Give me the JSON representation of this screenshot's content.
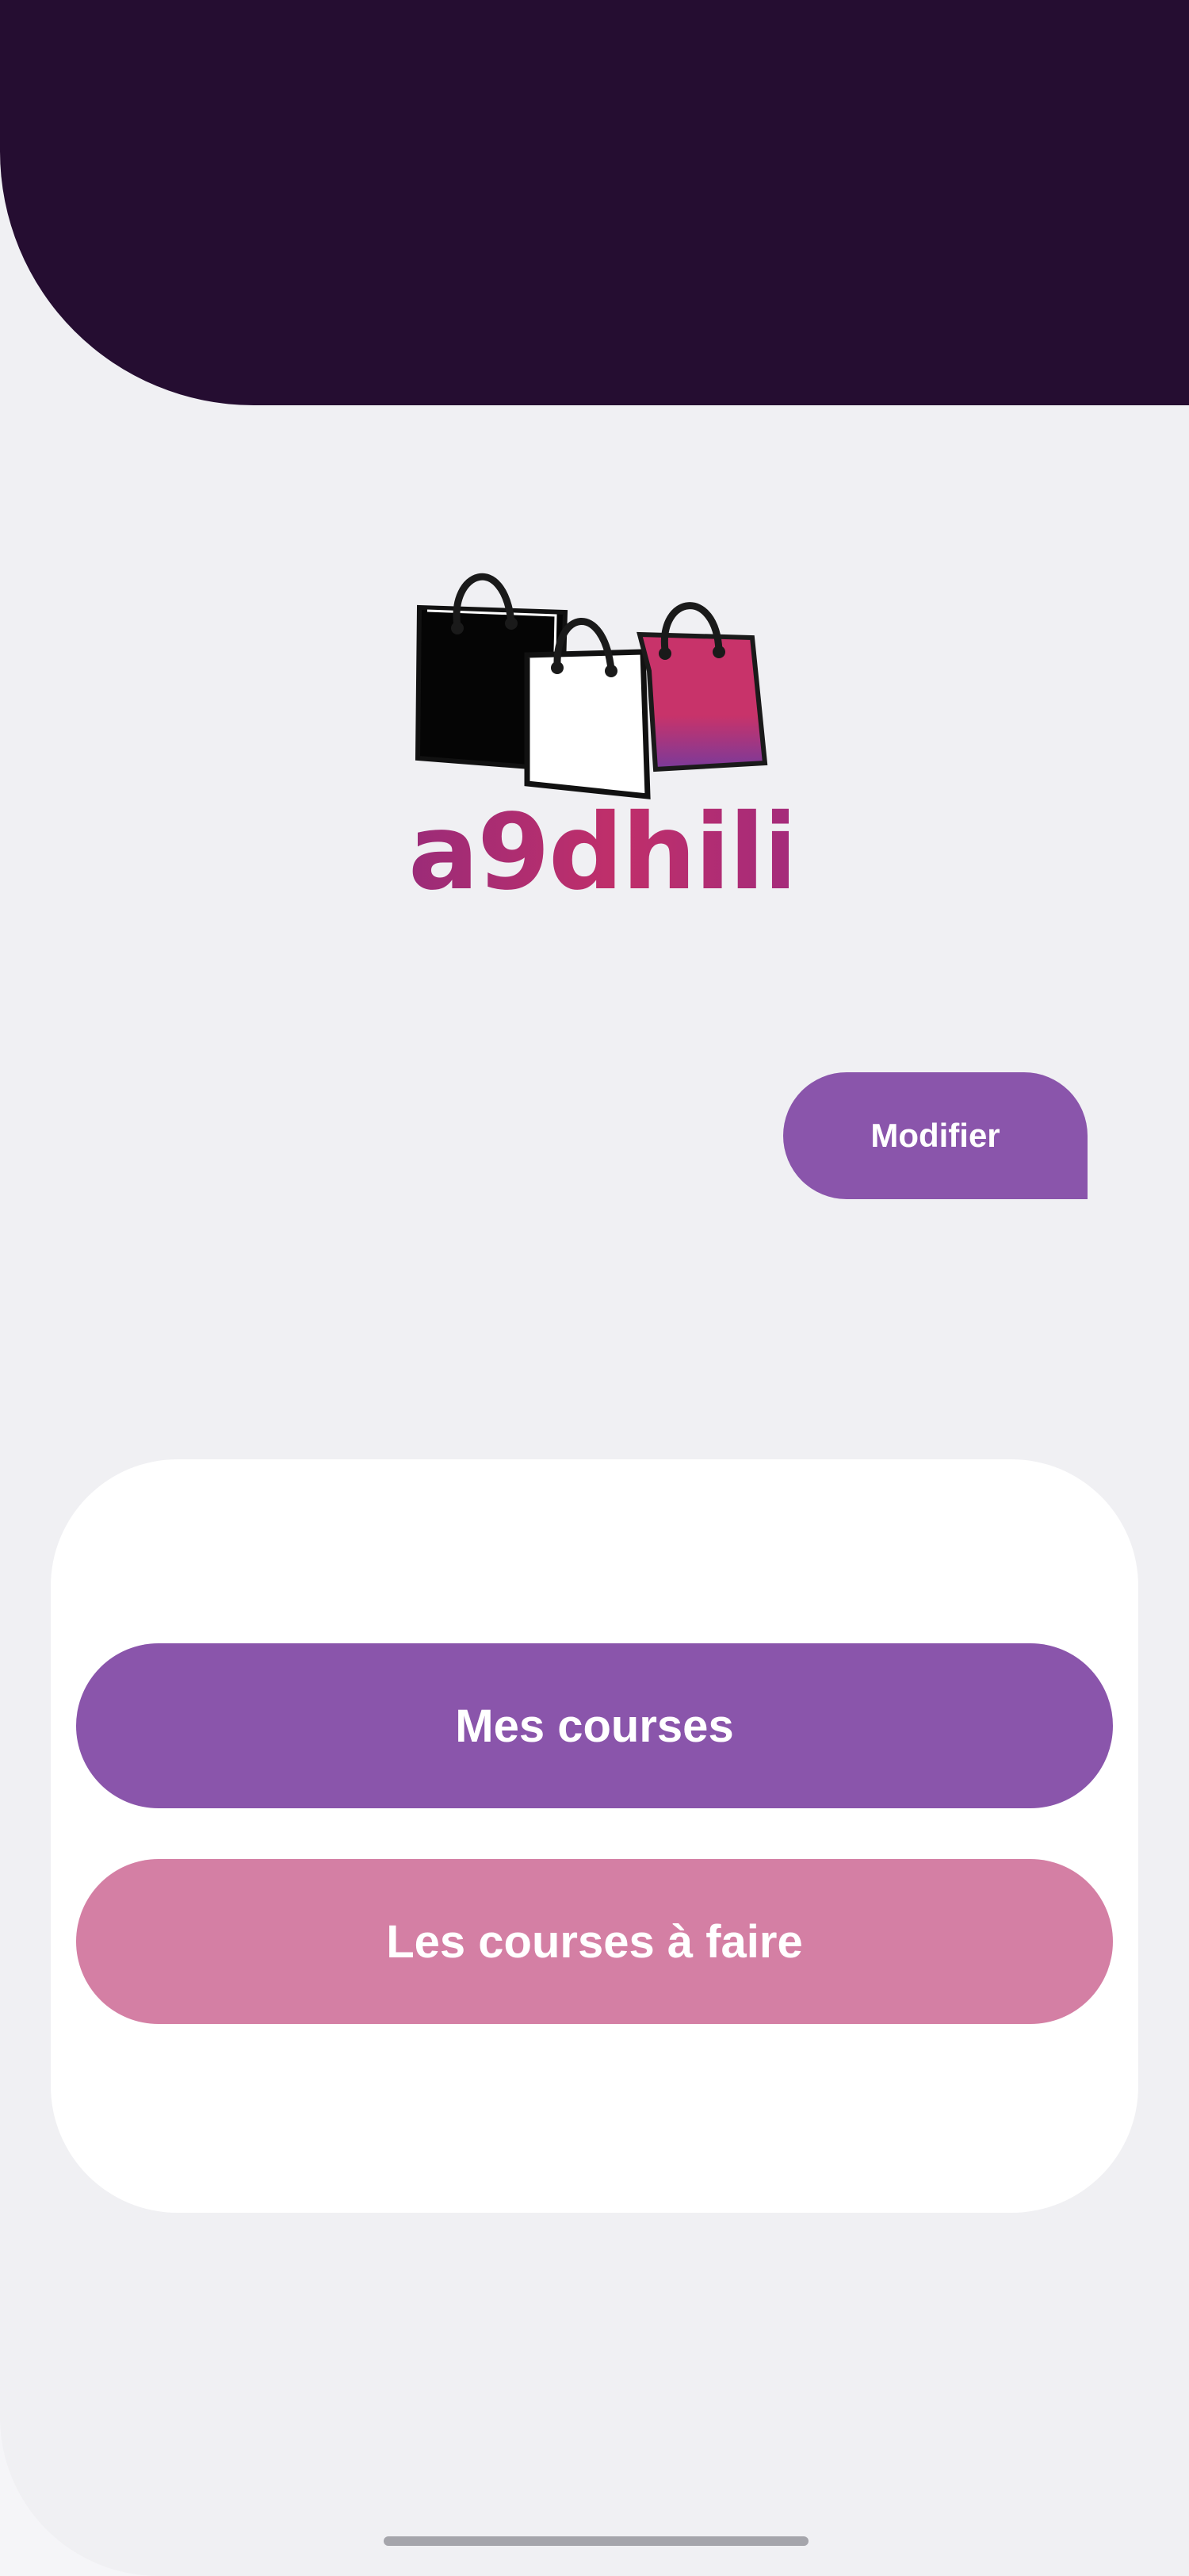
{
  "header": {
    "background_color": "#250d31"
  },
  "logo": {
    "wordmark": "a9dhili",
    "icon": "shopping-bags-icon",
    "colors": {
      "bag_black": "#050505",
      "bag_white": "#ffffff",
      "bag_pink": "#c8336a",
      "wordmark": "#b02f74"
    }
  },
  "actions": {
    "modify_label": "Modifier"
  },
  "menu": {
    "buttons": [
      {
        "label": "Mes courses",
        "color": "#8a55ab"
      },
      {
        "label": "Les courses à faire",
        "color": "#d47fa4"
      }
    ]
  },
  "theme": {
    "accent": "#8a55ab",
    "accent_pink": "#d47fa4",
    "background": "#f0f0f3",
    "card": "#ffffff"
  }
}
